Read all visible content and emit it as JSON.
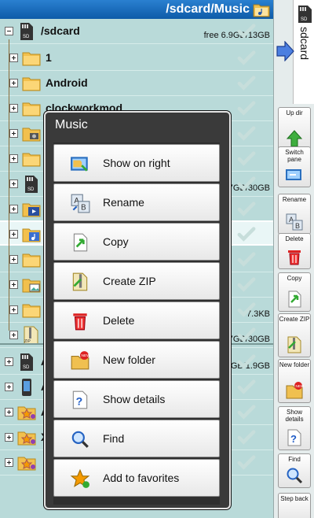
{
  "titlebar": {
    "path_prefix": "/sdcard/",
    "path_current": "Music"
  },
  "root_row": {
    "name": "/sdcard",
    "size": "free 6.9GB/13GB"
  },
  "file_rows": [
    {
      "name": "1",
      "size": ""
    },
    {
      "name": "Android",
      "size": ""
    },
    {
      "name": "clockworkmod",
      "size": ""
    },
    {
      "name": "",
      "size": ""
    },
    {
      "name": "",
      "size": ""
    },
    {
      "name": "",
      "size": "7GB/30GB"
    },
    {
      "name": "",
      "size": ""
    },
    {
      "name": "",
      "size": ""
    },
    {
      "name": "",
      "size": ""
    },
    {
      "name": "",
      "size": ""
    },
    {
      "name": "",
      "size": "7.3KB"
    },
    {
      "name": "A",
      "size": "7GB/30GB"
    },
    {
      "name": "A",
      "size": "GB/1.9GB"
    },
    {
      "name": "A",
      "size": ""
    },
    {
      "name": "A",
      "size": ""
    },
    {
      "name": "X",
      "size": ""
    }
  ],
  "side_tab": {
    "label": "sdcard"
  },
  "toolbar": {
    "up_dir": "Up dir",
    "switch_pane": "Switch pane",
    "rename": "Rename",
    "delete": "Delete",
    "copy": "Copy",
    "create_zip": "Create ZIP",
    "new_folder": "New folder",
    "show_details": "Show details",
    "find": "Find",
    "step_back": "Step back"
  },
  "dialog": {
    "title": "Music",
    "items": [
      {
        "label": "Show on right",
        "icon": "show-on-right-icon"
      },
      {
        "label": "Rename",
        "icon": "rename-icon"
      },
      {
        "label": "Copy",
        "icon": "copy-icon"
      },
      {
        "label": "Create ZIP",
        "icon": "zip-icon"
      },
      {
        "label": "Delete",
        "icon": "trash-icon"
      },
      {
        "label": "New folder",
        "icon": "new-folder-icon"
      },
      {
        "label": "Show details",
        "icon": "details-icon"
      },
      {
        "label": "Find",
        "icon": "magnifier-icon"
      },
      {
        "label": "Add to favorites",
        "icon": "star-icon"
      }
    ]
  },
  "colors": {
    "titlebar": "#1a6cbf",
    "list_bg": "#b9dad9",
    "dialog_bg": "#3a3a3a"
  }
}
